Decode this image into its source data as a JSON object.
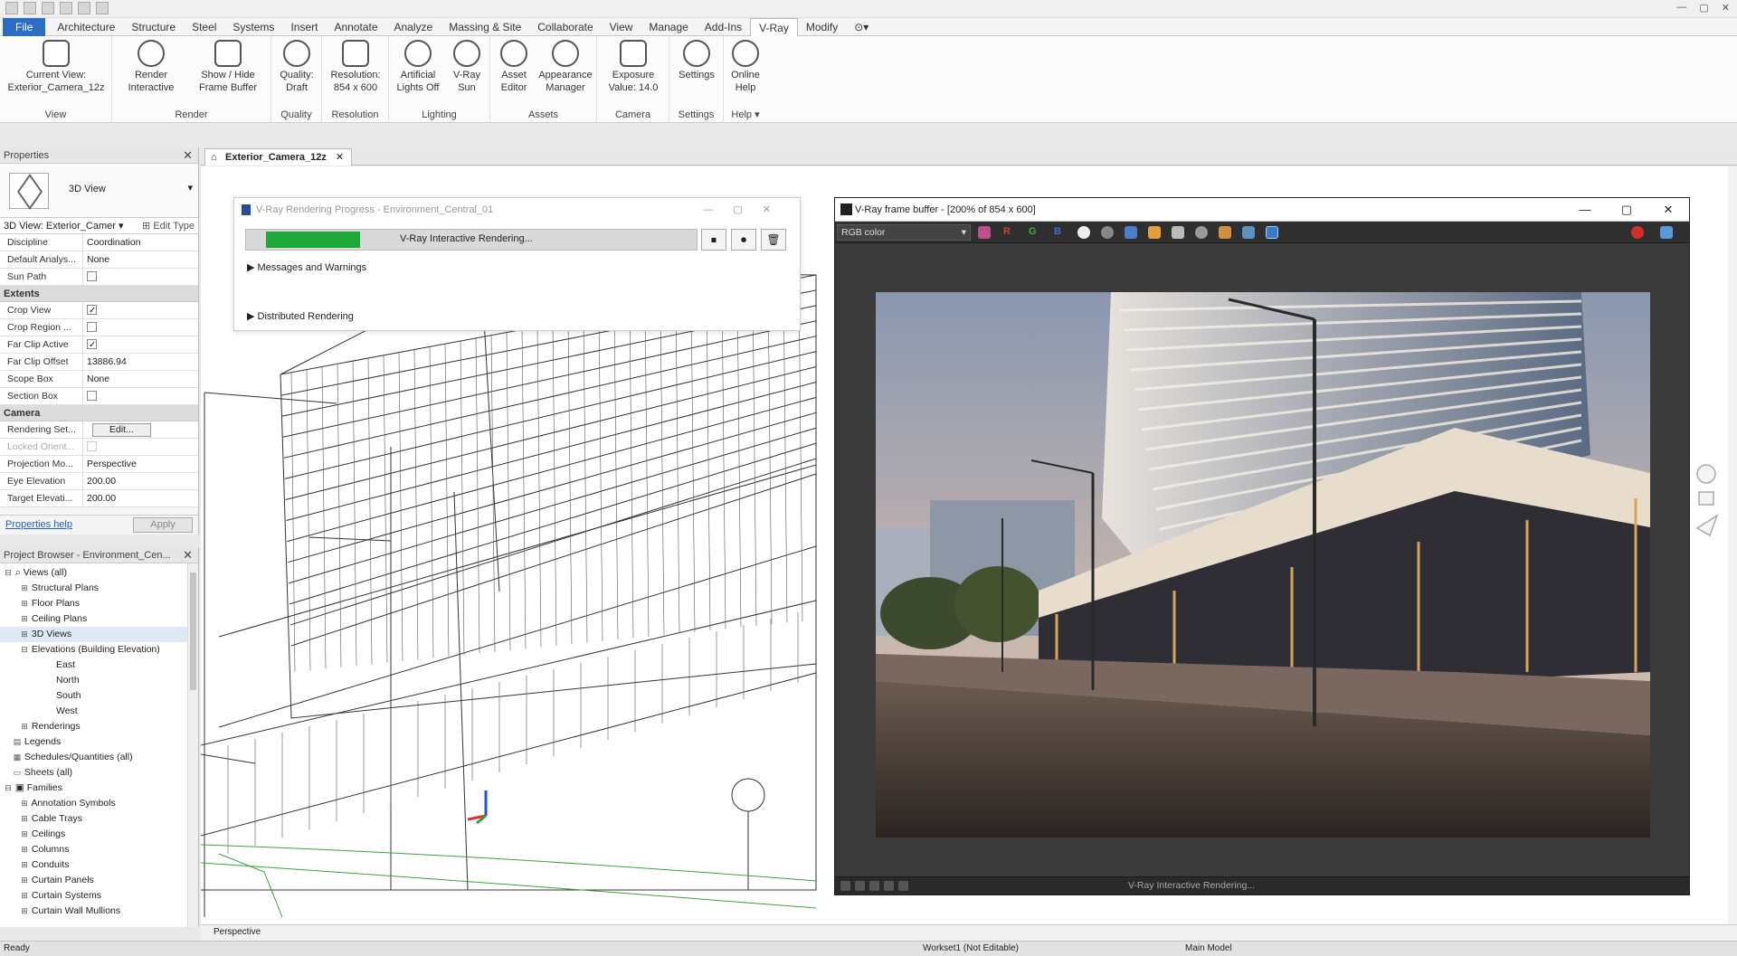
{
  "tabs": [
    "File",
    "Architecture",
    "Structure",
    "Steel",
    "Systems",
    "Insert",
    "Annotate",
    "Analyze",
    "Massing & Site",
    "Collaborate",
    "View",
    "Manage",
    "Add-Ins",
    "V-Ray",
    "Modify"
  ],
  "ribbon": {
    "view": {
      "btn1_l1": "Current View:",
      "btn1_l2": "Exterior_Camera_12z",
      "group": "View"
    },
    "render": {
      "btn1_l1": "Render",
      "btn1_l2": "Interactive",
      "btn2_l1": "Show / Hide",
      "btn2_l2": "Frame Buffer",
      "group": "Render"
    },
    "quality": {
      "btn1_l1": "Quality:",
      "btn1_l2": "Draft",
      "group": "Quality"
    },
    "resolution": {
      "btn1_l1": "Resolution:",
      "btn1_l2": "854 x 600",
      "group": "Resolution"
    },
    "lighting": {
      "btn1_l1": "Artificial",
      "btn1_l2": "Lights Off",
      "btn2_l1": "V-Ray",
      "btn2_l2": "Sun",
      "group": "Lighting"
    },
    "assets": {
      "btn1_l1": "Asset",
      "btn1_l2": "Editor",
      "btn2_l1": "Appearance",
      "btn2_l2": "Manager",
      "group": "Assets"
    },
    "camera": {
      "btn1_l1": "Exposure",
      "btn1_l2": "Value: 14.0",
      "group": "Camera"
    },
    "settings": {
      "btn1_l1": "Settings",
      "group": "Settings"
    },
    "help": {
      "btn1_l1": "Online",
      "btn1_l2": "Help",
      "group": "Help"
    }
  },
  "properties": {
    "title": "Properties",
    "type_name": "3D View",
    "instance": "3D View: Exterior_Camer",
    "edit_type": "Edit Type",
    "rows_top": [
      {
        "k": "Discipline",
        "v": "Coordination"
      },
      {
        "k": "Default Analys...",
        "v": "None"
      },
      {
        "k": "Sun Path",
        "v": ""
      }
    ],
    "sec_extents": "Extents",
    "rows_extents": [
      {
        "k": "Crop View",
        "v": ""
      },
      {
        "k": "Crop Region ...",
        "v": ""
      },
      {
        "k": "Far Clip Active",
        "v": ""
      },
      {
        "k": "Far Clip Offset",
        "v": "13886.94"
      },
      {
        "k": "Scope Box",
        "v": "None"
      },
      {
        "k": "Section Box",
        "v": ""
      }
    ],
    "sec_camera": "Camera",
    "rows_camera": [
      {
        "k": "Rendering Set...",
        "v": "Edit..."
      },
      {
        "k": "Locked Orient...",
        "v": ""
      },
      {
        "k": "Projection Mo...",
        "v": "Perspective"
      },
      {
        "k": "Eye Elevation",
        "v": "200.00"
      },
      {
        "k": "Target Elevati...",
        "v": "200.00"
      }
    ],
    "help": "Properties help",
    "apply": "Apply"
  },
  "browser": {
    "title": "Project Browser - Environment_Cen...",
    "items": [
      "Views (all)",
      "Structural Plans",
      "Floor Plans",
      "Ceiling Plans",
      "3D Views",
      "Elevations (Building Elevation)",
      "East",
      "North",
      "South",
      "West",
      "Renderings",
      "Legends",
      "Schedules/Quantities (all)",
      "Sheets (all)",
      "Families",
      "Annotation Symbols",
      "Cable Trays",
      "Ceilings",
      "Columns",
      "Conduits",
      "Curtain Panels",
      "Curtain Systems",
      "Curtain Wall Mullions"
    ]
  },
  "view_tab": "Exterior_Camera_12z",
  "progress": {
    "title": "V-Ray Rendering Progress - Environment_Central_01",
    "status": "V-Ray Interactive Rendering...",
    "fraction": 0.23,
    "messages": "Messages and Warnings",
    "distributed": "Distributed Rendering"
  },
  "vfb": {
    "title": "V-Ray frame buffer - [200% of 854 x 600]",
    "channel": "RGB color",
    "status": "V-Ray Interactive Rendering..."
  },
  "view_control": "Perspective",
  "status": {
    "left": "Ready",
    "workset": "Workset1 (Not Editable)",
    "model": "Main Model"
  },
  "colors": {
    "progress_fill": "#1fa83a",
    "file_tab": "#2b6cc4",
    "vfb_bg": "#3a3a3a"
  }
}
